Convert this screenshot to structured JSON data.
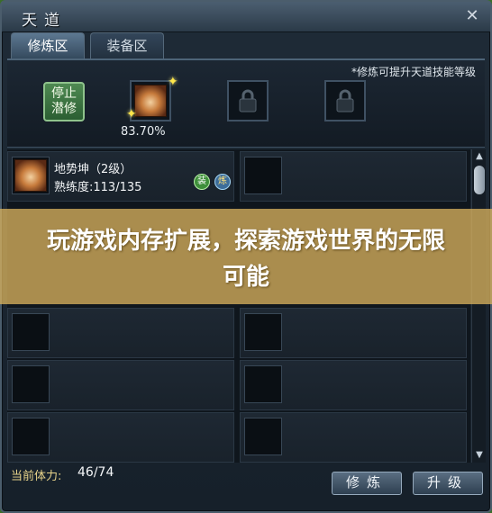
{
  "window": {
    "title": "天道"
  },
  "tabs": [
    {
      "label": "修炼区",
      "active": true
    },
    {
      "label": "装备区",
      "active": false
    }
  ],
  "top": {
    "hint": "*修炼可提升天道技能等级",
    "stop_button": "停止\n潜修",
    "stop_line1": "停止",
    "stop_line2": "潜修",
    "progress_percent": "83.70%",
    "slots": [
      {
        "icon": "fist-skill-icon",
        "locked": false
      },
      {
        "icon": "lock-icon",
        "locked": true
      },
      {
        "icon": "lock-icon",
        "locked": true
      }
    ]
  },
  "skills": [
    {
      "name": "地势坤（2级）",
      "proficiency": "熟练度:113/135",
      "badge_equip": "装",
      "badge_train": "炼"
    }
  ],
  "banner": {
    "text": "玩游戏内存扩展，探索游戏世界的无限可能"
  },
  "footer": {
    "stamina_label": "当前体力:",
    "stamina_value": "46/74",
    "train_button": "修炼",
    "upgrade_button": "升级"
  },
  "colors": {
    "accent_green": "#3e8f3a",
    "banner": "#d6b05c"
  }
}
